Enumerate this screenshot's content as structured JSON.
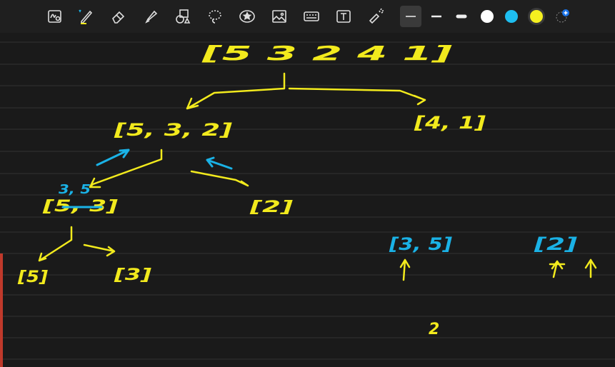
{
  "toolbar": {
    "tools": [
      {
        "name": "handwriting-search-tool",
        "active": false
      },
      {
        "name": "pen-tool",
        "active": false
      },
      {
        "name": "eraser-tool",
        "active": false
      },
      {
        "name": "highlighter-tool",
        "active": false
      },
      {
        "name": "shapes-tool",
        "active": false
      },
      {
        "name": "lasso-tool",
        "active": false
      },
      {
        "name": "sticker-tool",
        "active": false
      },
      {
        "name": "image-tool",
        "active": false
      },
      {
        "name": "keyboard-tool",
        "active": false
      },
      {
        "name": "textbox-tool",
        "active": false
      },
      {
        "name": "laser-pointer-tool",
        "active": false
      }
    ],
    "stroke_widths": [
      "thin",
      "medium",
      "thick"
    ],
    "colors": [
      "#ffffff",
      "#1ebef0",
      "#f5f020"
    ],
    "selected_color": "#f5f020",
    "add_color_label": "+"
  },
  "canvas": {
    "background": "#1a1a1a",
    "ruled_line_color": "#333333",
    "ink_colors": {
      "yellow": "#f2ea1d",
      "blue": "#1ab2e6"
    },
    "notes": {
      "root_array": "[5 3 2 4 1]",
      "left_half": "[5, 3, 2]",
      "right_half": "[4, 1]",
      "left_left": "[5, 3]",
      "left_right": "[2]",
      "leaf_5": "[5]",
      "leaf_3": "[3]",
      "merged_35": "3, 5",
      "result_35": "[3, 5]",
      "result_2": "[2]",
      "bottom_number": "2"
    }
  }
}
